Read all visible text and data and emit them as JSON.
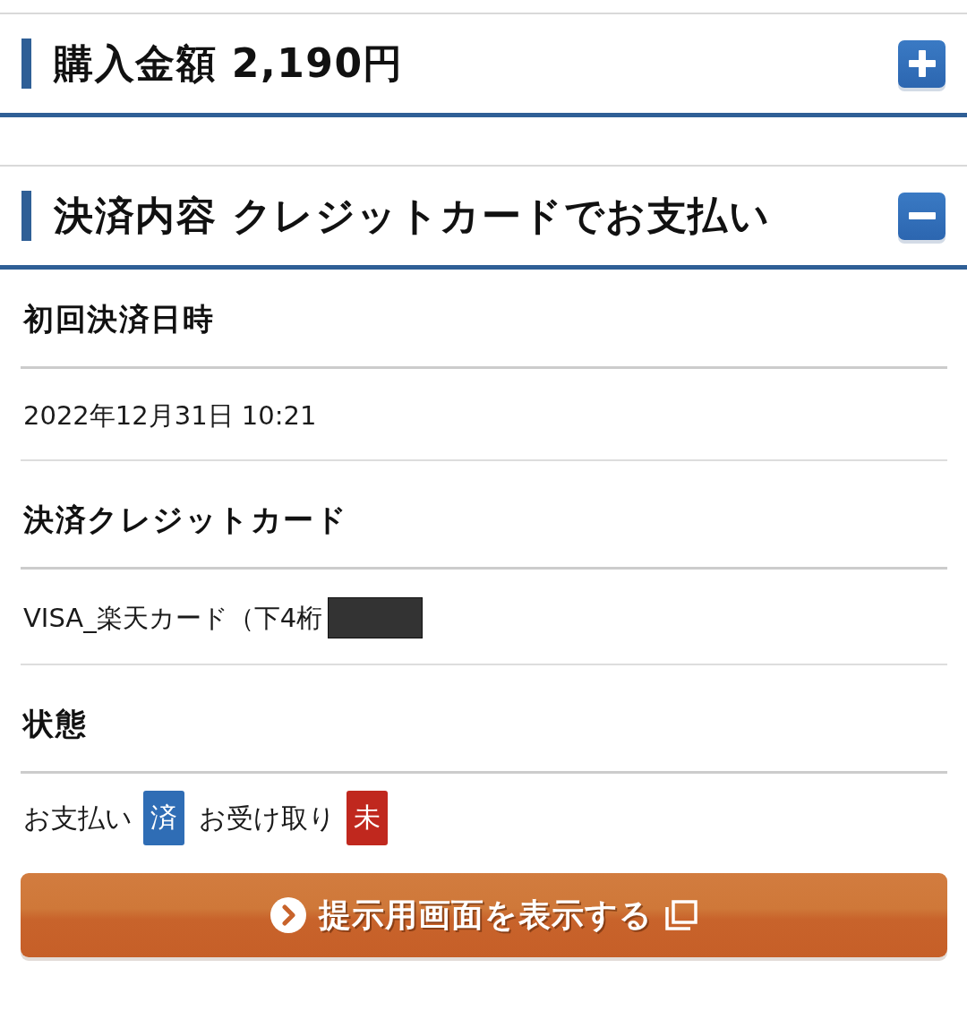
{
  "sections": [
    {
      "title": "購入金額 2,190円",
      "expanded": false
    },
    {
      "title": "決済内容 クレジットカードでお支払い",
      "expanded": true,
      "rows": [
        {
          "kind": "label",
          "text": "初回決済日時"
        },
        {
          "kind": "value",
          "text": "2022年12月31日 10:21"
        },
        {
          "kind": "label",
          "text": "決済クレジットカード"
        },
        {
          "kind": "value",
          "text": "VISA_楽天カード（下4桁",
          "redacted": true
        },
        {
          "kind": "label",
          "text": "状態"
        },
        {
          "kind": "status",
          "items": [
            {
              "label": "お支払い",
              "badge": "済",
              "color": "#2f6db5"
            },
            {
              "label": "お受け取り",
              "badge": "未",
              "color": "#c0281e"
            }
          ]
        }
      ]
    }
  ],
  "action_button": {
    "label": "提示用画面を表示する"
  }
}
